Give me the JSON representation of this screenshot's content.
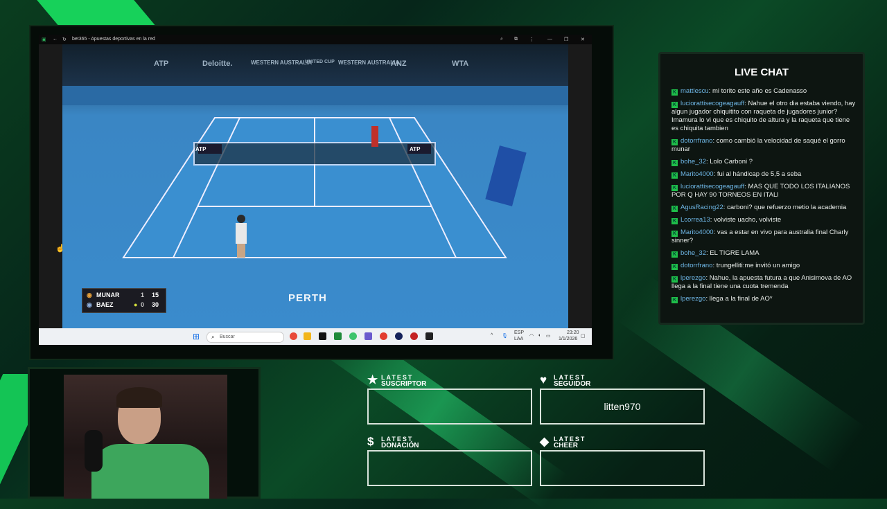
{
  "browser": {
    "tab_title": "bet365 - Apuestas deportivas en la red"
  },
  "video": {
    "sponsors": [
      "ATP",
      "Deloitte.",
      "WESTERN AUSTRALIA",
      "UNITED CUP",
      "WESTERN AUSTRALIA",
      "ANZ",
      "WTA"
    ],
    "net_brand": "ATP",
    "venue_text": "PERTH",
    "scoreboard": {
      "players": [
        {
          "name": "MUNAR",
          "sets": "1",
          "points": "15"
        },
        {
          "name": "BAEZ",
          "sets": "0",
          "points": "30"
        }
      ]
    }
  },
  "taskbar": {
    "search_placeholder": "Buscar",
    "lang_top": "ESP",
    "lang_bottom": "LAA",
    "time": "23:20",
    "date": "1/1/2026"
  },
  "chat": {
    "title": "LIVE CHAT",
    "messages": [
      {
        "user": "mattlescu",
        "text": "mi torito este año es Cadenasso"
      },
      {
        "user": "luciorattisecogeagauff",
        "text": "Nahue el otro dia estaba viendo, hay algun jugador chiquitito con raqueta de jugadores junior? Imamura lo vi que es chiquito de altura y la raqueta que tiene es chiquita tambien"
      },
      {
        "user": "dotorrfrano",
        "text": "como cambió la velocidad de saqué el gorro munar"
      },
      {
        "user": "bohe_32",
        "text": "Lolo Carboni ?"
      },
      {
        "user": "Marito4000",
        "text": "fui al hándicap de 5,5 a seba"
      },
      {
        "user": "luciorattisecogeagauff",
        "text": "MAS QUE TODO LOS ITALIANOS POR Q HAY 90 TORNEOS EN ITALI"
      },
      {
        "user": "AgusRacing22",
        "text": "carboni? que refuerzo metio la academia"
      },
      {
        "user": "Lcorrea13",
        "text": "volviste uacho, volviste"
      },
      {
        "user": "Marito4000",
        "text": "vas a estar en vivo para australia final Charly sinner?"
      },
      {
        "user": "bohe_32",
        "text": "EL TIGRE LAMA"
      },
      {
        "user": "dotorrfrano",
        "text": "trungelliti:me invitó un amigo"
      },
      {
        "user": "lperezgo",
        "text": "Nahue, la apuesta futura a que Anisimova de AO llega a la final tiene una cuota tremenda"
      },
      {
        "user": "lperezgo",
        "text": "llega a la final de AO*"
      }
    ]
  },
  "latest": {
    "top_word": "LATEST",
    "suscriptor": {
      "label": "SUSCRIPTOR",
      "value": ""
    },
    "seguidor": {
      "label": "SEGUIDOR",
      "value": "litten970"
    },
    "donacion": {
      "label": "DONACIÓN",
      "value": ""
    },
    "cheer": {
      "label": "CHEER",
      "value": ""
    }
  },
  "colors": {
    "accent": "#1fbf4a",
    "chat_user": "#6fb7e6",
    "court": "#3a8bcc"
  }
}
